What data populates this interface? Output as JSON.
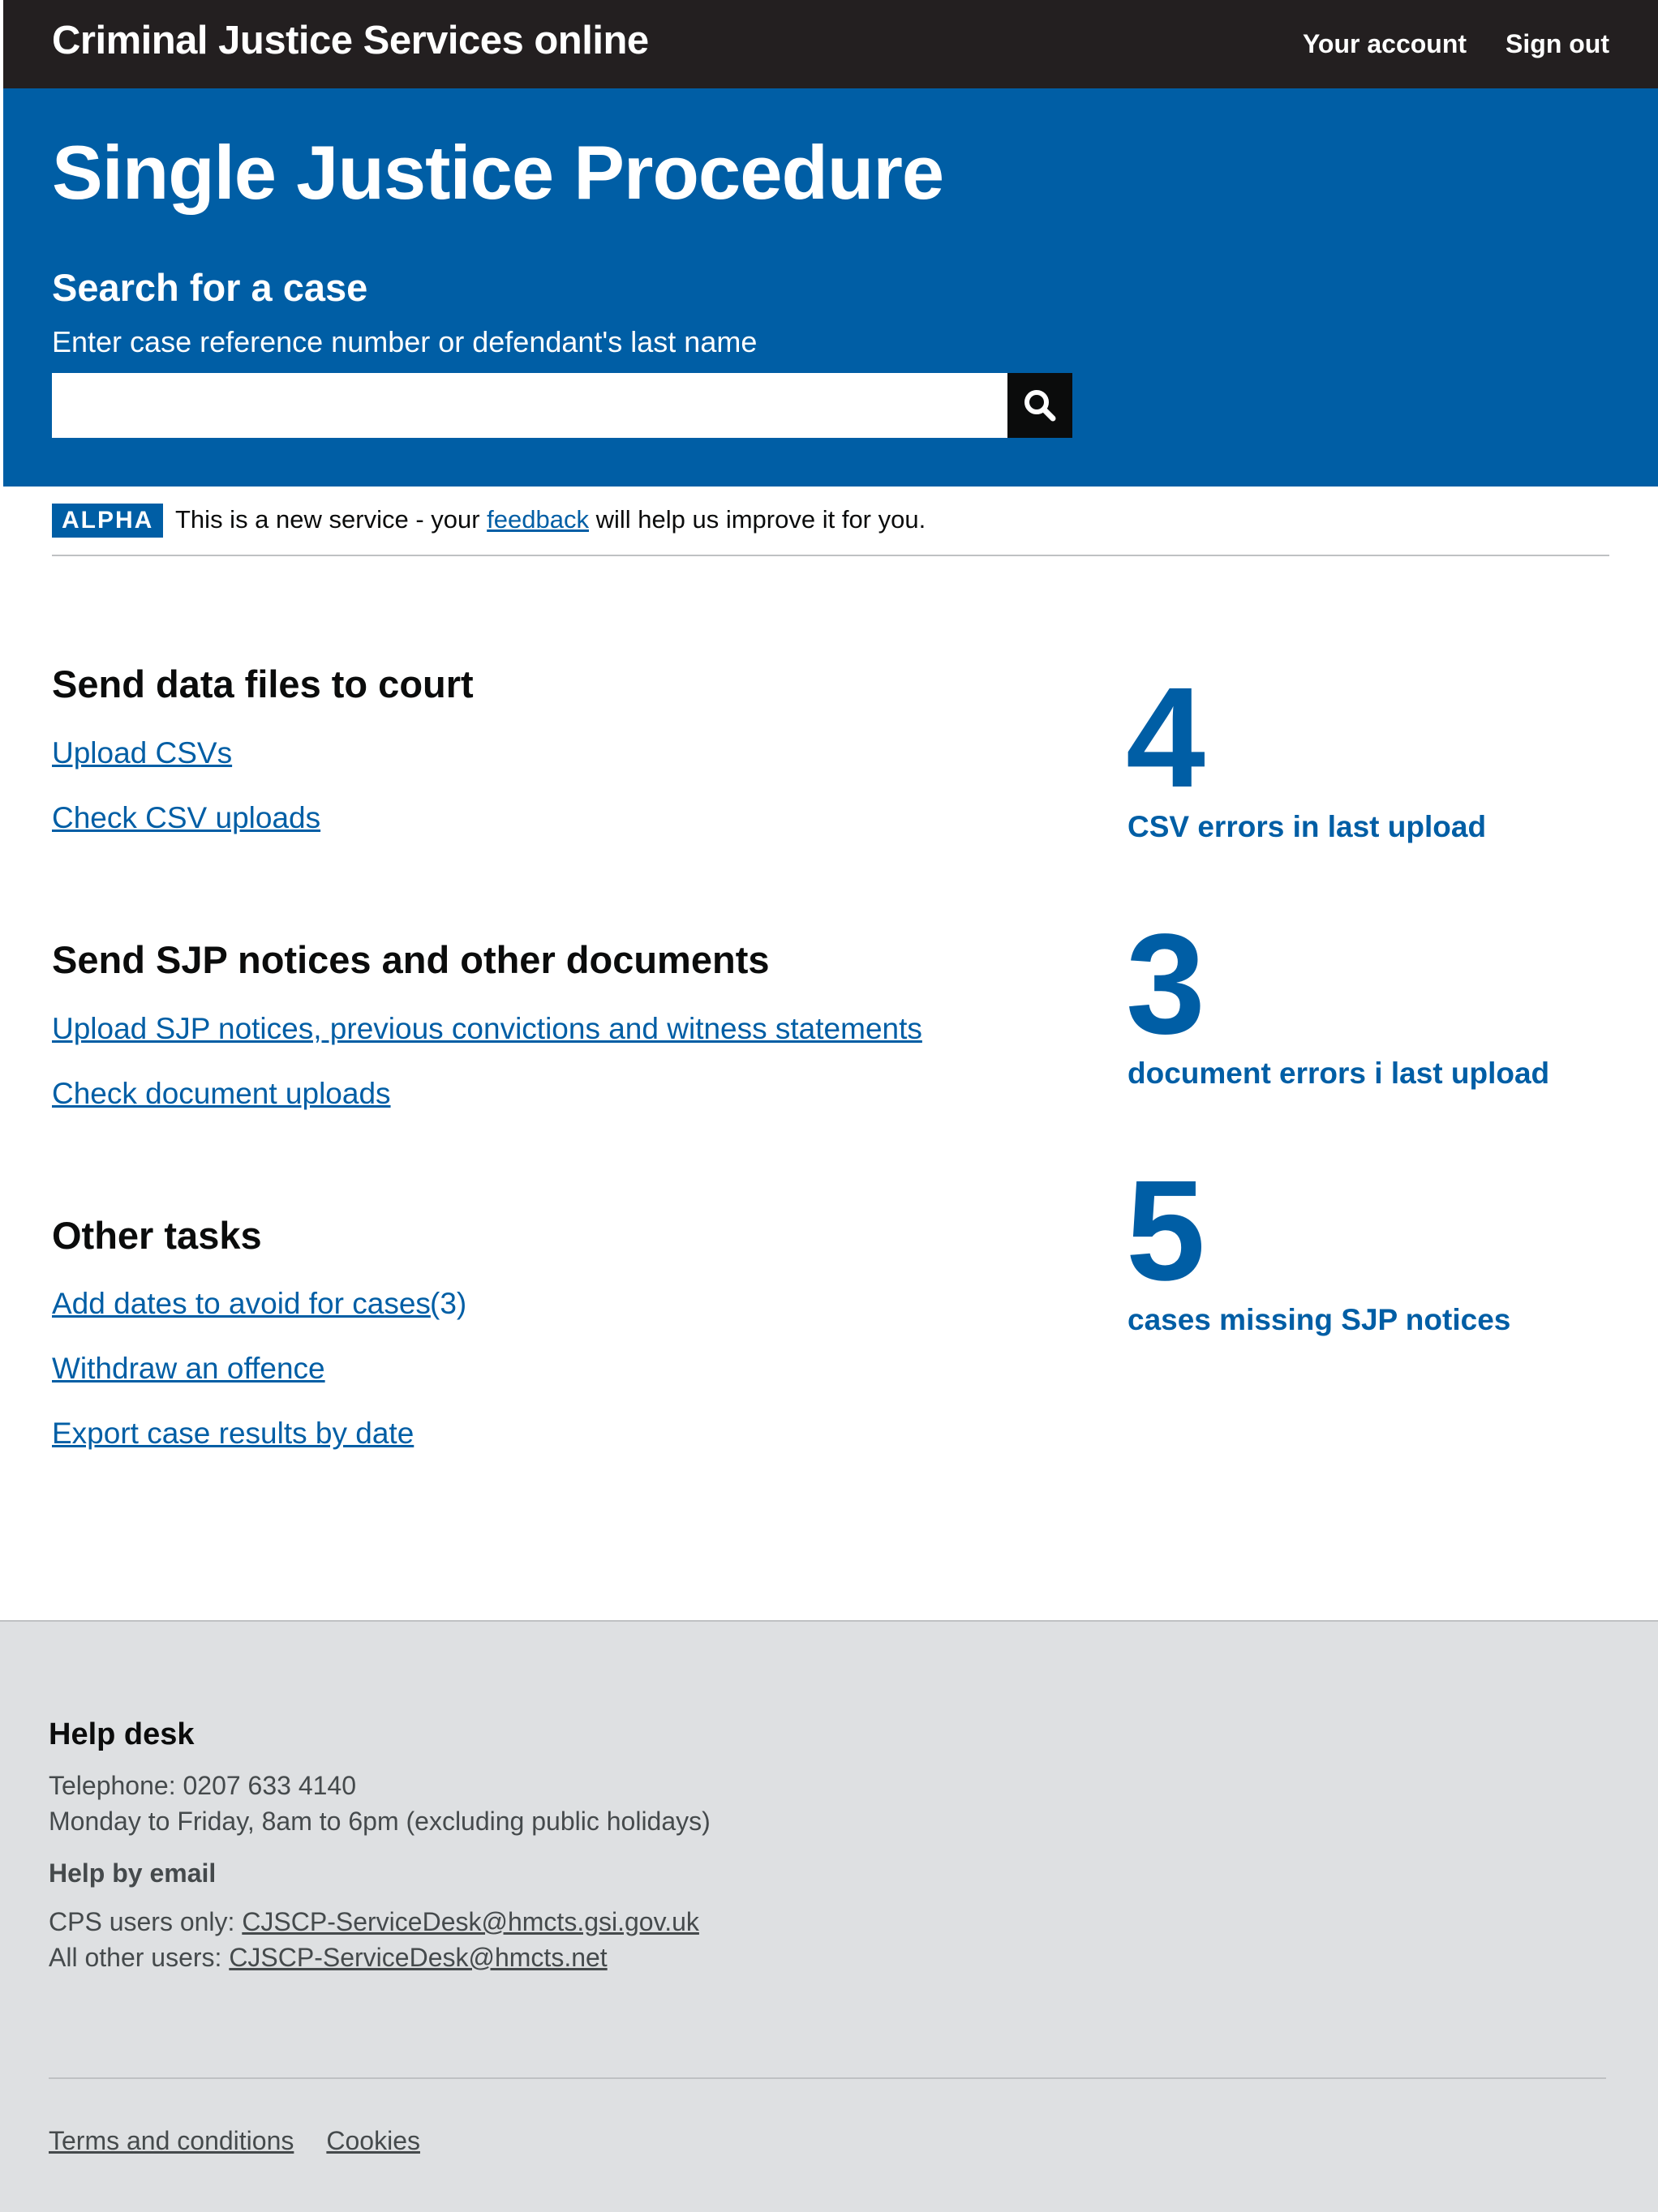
{
  "header": {
    "service_name": "Criminal Justice Services online",
    "nav": [
      {
        "label": "Your account"
      },
      {
        "label": "Sign out"
      }
    ]
  },
  "hero": {
    "title": "Single Justice Procedure",
    "search": {
      "heading": "Search for a case",
      "hint": "Enter case reference number or defendant's last name",
      "value": "",
      "button_icon": "search-icon"
    }
  },
  "phase_banner": {
    "tag": "ALPHA",
    "text_before": "This is a new service - your ",
    "link": "feedback",
    "text_after": " will help us improve it for you."
  },
  "sections": [
    {
      "heading": "Send data files to court",
      "links": [
        {
          "label": "Upload CSVs"
        },
        {
          "label": "Check CSV uploads"
        }
      ]
    },
    {
      "heading": "Send SJP notices and other documents",
      "links": [
        {
          "label": "Upload SJP notices, previous convictions and witness statements"
        },
        {
          "label": "Check document uploads"
        }
      ]
    },
    {
      "heading": "Other tasks",
      "links": [
        {
          "label": "Add dates to avoid for cases",
          "count": "(3)"
        },
        {
          "label": "Withdraw an offence"
        },
        {
          "label": "Export case results by date"
        }
      ]
    }
  ],
  "stats": [
    {
      "value": "4",
      "label": "CSV errors in last upload"
    },
    {
      "value": "3",
      "label": "document errors i last upload"
    },
    {
      "value": "5",
      "label": "cases missing SJP notices"
    }
  ],
  "footer": {
    "help_heading": "Help desk",
    "telephone": "Telephone: 0207 633 4140",
    "hours": "Monday to Friday, 8am to 6pm (excluding public holidays)",
    "email_heading": "Help by email",
    "cps_prefix": "CPS users only: ",
    "cps_email": "CJSCP-ServiceDesk@hmcts.gsi.gov.uk",
    "other_prefix": "All other users: ",
    "other_email": "CJSCP-ServiceDesk@hmcts.net",
    "links": [
      {
        "label": "Terms and conditions"
      },
      {
        "label": "Cookies"
      }
    ]
  },
  "colors": {
    "header_bg": "#231f20",
    "brand_blue": "#005ea5",
    "footer_bg": "#dee0e2"
  }
}
